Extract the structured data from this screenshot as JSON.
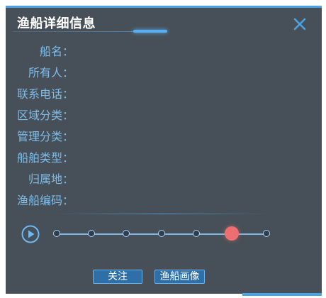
{
  "dialog": {
    "title": "渔船详细信息"
  },
  "fields": [
    {
      "label": "船名：",
      "value": ""
    },
    {
      "label": "所有人：",
      "value": ""
    },
    {
      "label": "联系电话：",
      "value": ""
    },
    {
      "label": "区域分类：",
      "value": ""
    },
    {
      "label": "管理分类：",
      "value": ""
    },
    {
      "label": "船舶类型：",
      "value": ""
    },
    {
      "label": "归属地：",
      "value": ""
    },
    {
      "label": "渔船编码：",
      "value": ""
    }
  ],
  "timeline": {
    "node_count": 7,
    "active_index": 5
  },
  "buttons": {
    "follow": "关注",
    "images": "渔船画像"
  },
  "colors": {
    "panel": "#475058",
    "accent": "#4aa3e6",
    "label": "#7fbce8",
    "active_node": "#ee6f6f"
  },
  "icons": {
    "close": "close-icon",
    "play": "play-icon"
  }
}
